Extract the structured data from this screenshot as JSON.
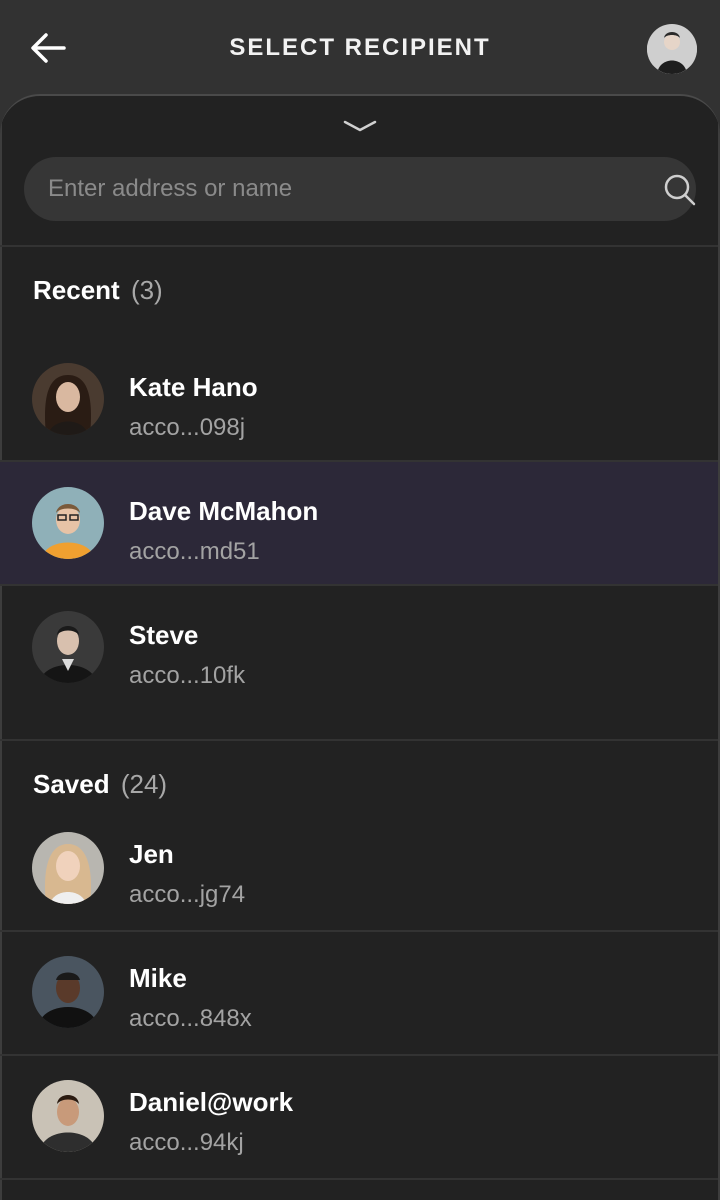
{
  "header": {
    "title": "SELECT RECIPIENT",
    "back_icon": "arrow-left-icon",
    "avatar_icon": "user-avatar"
  },
  "search": {
    "placeholder": "Enter address or name",
    "icon": "search-icon"
  },
  "recent": {
    "label": "Recent",
    "count": "(3)",
    "items": [
      {
        "name": "Kate Hano",
        "address": "acco...098j",
        "selected": false
      },
      {
        "name": "Dave McMahon",
        "address": "acco...md51",
        "selected": true
      },
      {
        "name": "Steve",
        "address": "acco...10fk",
        "selected": false
      }
    ]
  },
  "saved": {
    "label": "Saved",
    "count": "(24)",
    "items": [
      {
        "name": "Jen",
        "address": "acco...jg74"
      },
      {
        "name": "Mike",
        "address": "acco...848x"
      },
      {
        "name": "Daniel@work",
        "address": "acco...94kj"
      }
    ]
  },
  "colors": {
    "background": "#222222",
    "selected_row": "#2c2838",
    "header": "#323232"
  }
}
